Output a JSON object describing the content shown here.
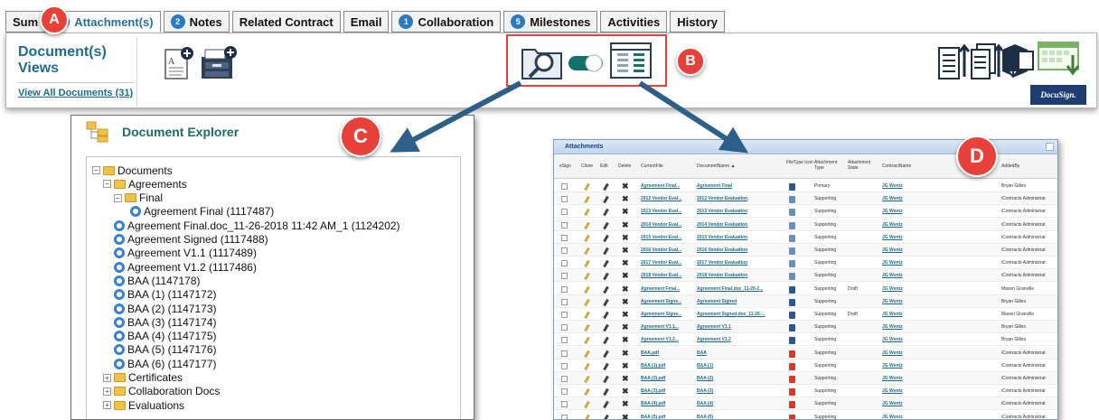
{
  "tabs": [
    {
      "label": "Sum",
      "count": "",
      "active": false
    },
    {
      "label": "Attachment(s)",
      "count": "31",
      "active": true
    },
    {
      "label": "Notes",
      "count": "2",
      "active": false
    },
    {
      "label": "Related Contract",
      "count": "",
      "active": false
    },
    {
      "label": "Email",
      "count": "",
      "active": false
    },
    {
      "label": "Collaboration",
      "count": "1",
      "active": false
    },
    {
      "label": "Milestones",
      "count": "5",
      "active": false
    },
    {
      "label": "Activities",
      "count": "",
      "active": false
    },
    {
      "label": "History",
      "count": "",
      "active": false
    }
  ],
  "views": {
    "title": "Document(s) Views",
    "link": "View All Documents (31)"
  },
  "badges": {
    "a": "A",
    "b": "B",
    "c": "C",
    "d": "D"
  },
  "docusign_label": "DocuSign.",
  "explorer": {
    "title": "Document Explorer",
    "tree": [
      {
        "label": "Documents",
        "type": "folder",
        "toggle": "−"
      },
      {
        "label": "Agreements",
        "type": "folder",
        "toggle": "−"
      },
      {
        "label": "Final",
        "type": "folder",
        "toggle": "−"
      },
      {
        "label": "Agreement Final (1117487)",
        "type": "doc"
      },
      {
        "label": "Agreement Final.doc_11-26-2018 11:42 AM_1 (1124202)",
        "type": "doc"
      },
      {
        "label": "Agreement Signed (1117488)",
        "type": "doc"
      },
      {
        "label": "Agreement V1.1 (1117489)",
        "type": "doc"
      },
      {
        "label": "Agreement V1.2 (1117486)",
        "type": "doc"
      },
      {
        "label": "BAA (1147178)",
        "type": "doc"
      },
      {
        "label": "BAA (1) (1147172)",
        "type": "doc"
      },
      {
        "label": "BAA (2) (1147173)",
        "type": "doc"
      },
      {
        "label": "BAA (3) (1147174)",
        "type": "doc"
      },
      {
        "label": "BAA (4) (1147175)",
        "type": "doc"
      },
      {
        "label": "BAA (5) (1147176)",
        "type": "doc"
      },
      {
        "label": "BAA (6) (1147177)",
        "type": "doc"
      },
      {
        "label": "Certificates",
        "type": "folder",
        "toggle": "+"
      },
      {
        "label": "Collaboration Docs",
        "type": "folder",
        "toggle": "+"
      },
      {
        "label": "Evaluations",
        "type": "folder",
        "toggle": "+"
      }
    ]
  },
  "grid": {
    "title": "Attachments",
    "headers": [
      "eSign",
      "Clone",
      "Edit",
      "Delete",
      "CurrentFile",
      "DocumentName ▲",
      "FileType Icon",
      "Attachment Type",
      "Attachment State",
      "ContractName",
      "AddedBy"
    ],
    "rows": [
      {
        "file": "Agreement Final...",
        "name": "Agreement Final",
        "icon": "word",
        "type": "Primary",
        "state": "",
        "contract": "JG Wentz",
        "by": "Bryan Gilles"
      },
      {
        "file": "2012 Vendor Eval...",
        "name": "2012 Vendor Evaluation",
        "icon": "excel",
        "type": "Supporting",
        "state": "",
        "contract": "JG Wentz",
        "by": "iContracts Administrat"
      },
      {
        "file": "2013 Vendor Eval...",
        "name": "2013 Vendor Evaluation",
        "icon": "excel",
        "type": "Supporting",
        "state": "",
        "contract": "JG Wentz",
        "by": "iContracts Administrat"
      },
      {
        "file": "2014 Vendor Eval...",
        "name": "2014 Vendor Evaluation",
        "icon": "excel",
        "type": "Supporting",
        "state": "",
        "contract": "JG Wentz",
        "by": "iContracts Administrat"
      },
      {
        "file": "2015 Vendor Eval...",
        "name": "2015 Vendor Evaluation",
        "icon": "excel",
        "type": "Supporting",
        "state": "",
        "contract": "JG Wentz",
        "by": "iContracts Administrat"
      },
      {
        "file": "2016 Vendor Eval...",
        "name": "2016 Vendor Evaluation",
        "icon": "excel",
        "type": "Supporting",
        "state": "",
        "contract": "JG Wentz",
        "by": "iContracts Administrat"
      },
      {
        "file": "2017 Vendor Eval...",
        "name": "2017 Vendor Evaluation",
        "icon": "excel",
        "type": "Supporting",
        "state": "",
        "contract": "JG Wentz",
        "by": "iContracts Administrat"
      },
      {
        "file": "2018 Vendor Eval...",
        "name": "2018 Vendor Evaluation",
        "icon": "excel",
        "type": "Supporting",
        "state": "",
        "contract": "JG Wentz",
        "by": "iContracts Administrat"
      },
      {
        "file": "Agreement Final...",
        "name": "Agreement Final.doc_11-26-2...",
        "icon": "word",
        "type": "Supporting",
        "state": "Draft",
        "contract": "JG Wentz",
        "by": "Mason Granville"
      },
      {
        "file": "Agreement Signe...",
        "name": "Agreement Signed",
        "icon": "word",
        "type": "Supporting",
        "state": "",
        "contract": "JG Wentz",
        "by": "Bryan Gilles"
      },
      {
        "file": "Agreement Signe...",
        "name": "Agreement Signed.doc_11-26-...",
        "icon": "word",
        "type": "Supporting",
        "state": "Draft",
        "contract": "JG Wentz",
        "by": "Mason Granville"
      },
      {
        "file": "Agreement V1.1...",
        "name": "Agreement V1.1",
        "icon": "word",
        "type": "Supporting",
        "state": "",
        "contract": "JG Wentz",
        "by": "Bryan Gilles"
      },
      {
        "file": "Agreement V1.2...",
        "name": "Agreement V1.2",
        "icon": "word",
        "type": "Supporting",
        "state": "",
        "contract": "JG Wentz",
        "by": "Bryan Gilles"
      },
      {
        "file": "BAA.pdf",
        "name": "BAA",
        "icon": "pdf",
        "type": "Supporting",
        "state": "",
        "contract": "JG Wentz",
        "by": "iContracts Administrat"
      },
      {
        "file": "BAA (1).pdf",
        "name": "BAA (1)",
        "icon": "pdf",
        "type": "Supporting",
        "state": "",
        "contract": "JG Wentz",
        "by": "iContracts Administrat"
      },
      {
        "file": "BAA (2).pdf",
        "name": "BAA (2)",
        "icon": "pdf",
        "type": "Supporting",
        "state": "",
        "contract": "JG Wentz",
        "by": "iContracts Administrat"
      },
      {
        "file": "BAA (3).pdf",
        "name": "BAA (3)",
        "icon": "pdf",
        "type": "Supporting",
        "state": "",
        "contract": "JG Wentz",
        "by": "iContracts Administrat"
      },
      {
        "file": "BAA (4).pdf",
        "name": "BAA (4)",
        "icon": "pdf",
        "type": "Supporting",
        "state": "",
        "contract": "JG Wentz",
        "by": "iContracts Administrat"
      },
      {
        "file": "BAA (5).pdf",
        "name": "BAA (5)",
        "icon": "pdf",
        "type": "Supporting",
        "state": "",
        "contract": "JG Wentz",
        "by": "iContracts Administrat"
      }
    ]
  },
  "colors": {
    "accent": "#1f6b8f",
    "badge": "#e8413a",
    "highlight_box": "#e8413a",
    "arrow": "#2d5f8a"
  }
}
